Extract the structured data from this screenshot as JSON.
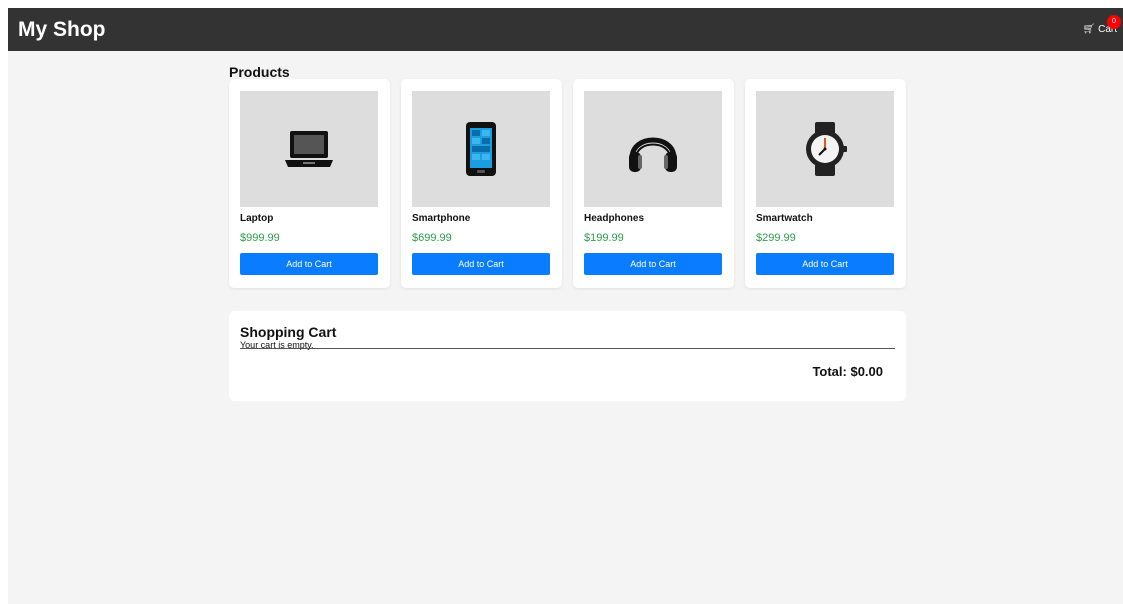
{
  "header": {
    "title": "My Shop",
    "cart_label": "Cart",
    "cart_count": "0",
    "cart_icon": "cart-icon"
  },
  "products": {
    "heading": "Products",
    "add_label": "Add to Cart",
    "items": [
      {
        "name": "Laptop",
        "price": "$999.99",
        "icon": "laptop-icon"
      },
      {
        "name": "Smartphone",
        "price": "$699.99",
        "icon": "smartphone-icon"
      },
      {
        "name": "Headphones",
        "price": "$199.99",
        "icon": "headphones-icon"
      },
      {
        "name": "Smartwatch",
        "price": "$299.99",
        "icon": "smartwatch-icon"
      }
    ]
  },
  "cart": {
    "title": "Shopping Cart",
    "empty_text": "Your cart is empty.",
    "total": "Total: $0.00"
  },
  "colors": {
    "header_bg": "#333333",
    "page_bg": "#f4f4f4",
    "button_bg": "#0a7cff",
    "price": "#2e9e4a",
    "badge": "#ff0000"
  }
}
